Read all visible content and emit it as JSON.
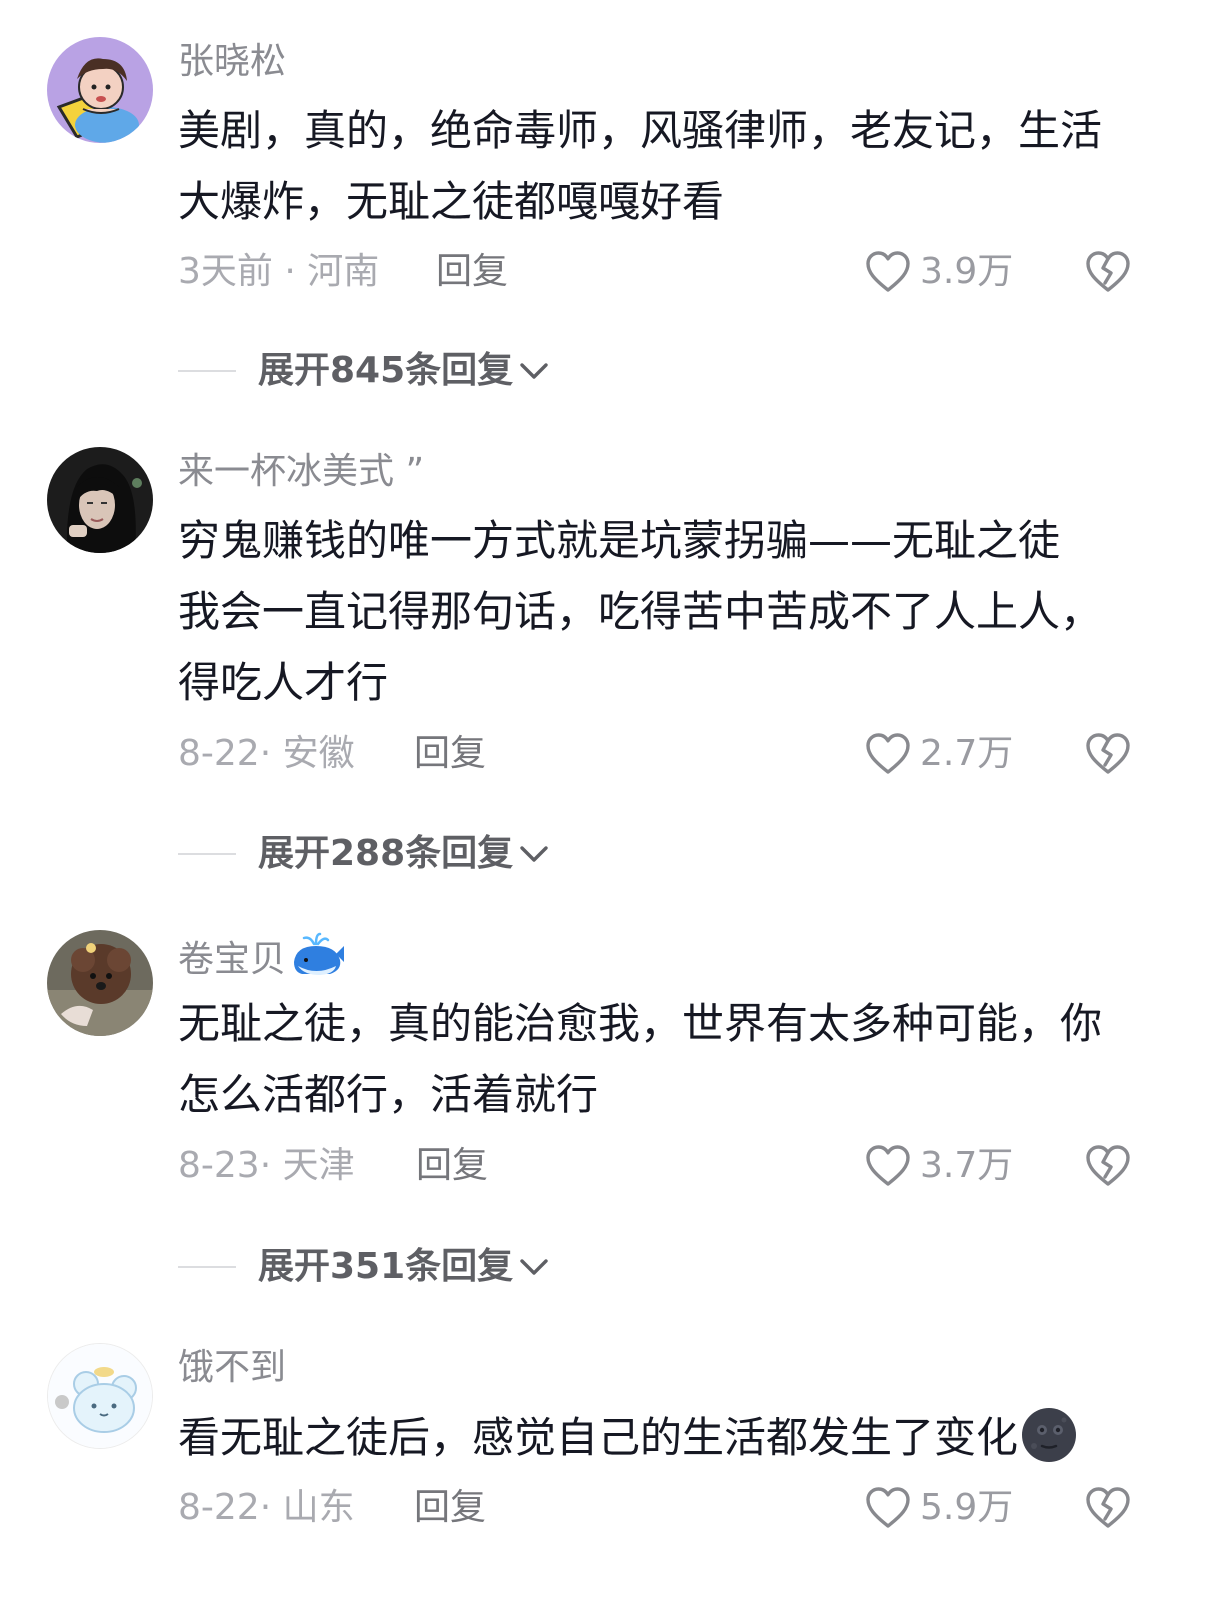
{
  "comments": [
    {
      "username": "张晓松",
      "lines": [
        "美剧，真的，绝命毒师，风骚律师，老友记，生活",
        "大爆炸，无耻之徒都嘎嘎好看"
      ],
      "date_location": "3天前 · 河南",
      "reply_label": "回复",
      "likes": "3.9万",
      "expand_label": "展开845条回复"
    },
    {
      "username": "来一杯冰美式 ”",
      "lines": [
        "穷鬼赚钱的唯一方式就是坑蒙拐骗——无耻之徒",
        "我会一直记得那句话，吃得苦中苦成不了人上人，",
        "得吃人才行"
      ],
      "date_location": "8-22· 安徽",
      "reply_label": "回复",
      "likes": "2.7万",
      "expand_label": "展开288条回复"
    },
    {
      "username": "卷宝贝",
      "username_emoji": "whale-icon",
      "lines": [
        "无耻之徒，真的能治愈我，世界有太多种可能，你",
        "怎么活都行，活着就行"
      ],
      "date_location": "8-23· 天津",
      "reply_label": "回复",
      "likes": "3.7万",
      "expand_label": "展开351条回复"
    },
    {
      "username": "饿不到",
      "lines": [
        "看无耻之徒后，感觉自己的生活都发生了变化"
      ],
      "trailing_emoji": "new-moon-face-icon",
      "date_location": "8-22· 山东",
      "reply_label": "回复",
      "likes": "5.9万"
    }
  ],
  "colors": {
    "text": "#161823",
    "username": "#8a8b91",
    "meta": "#a9aab0",
    "reply": "#75767b",
    "expand": "#5e5f64"
  }
}
